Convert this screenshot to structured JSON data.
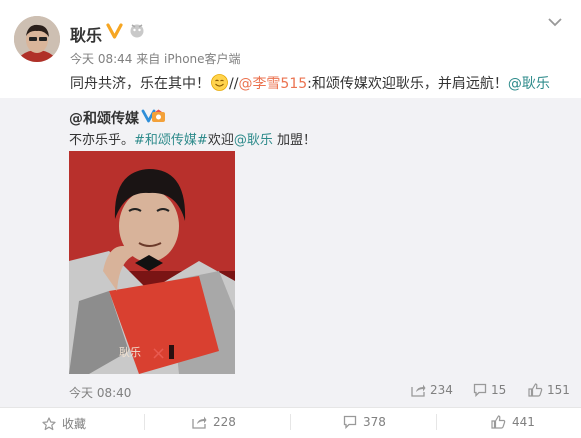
{
  "post": {
    "author": "耿乐",
    "meta": "今天 08:44 来自 iPhone客户端",
    "content_prefix": "同舟共济，乐在其中！",
    "content_sep": "//",
    "mention1": "@李雪515",
    "content_mid": ":和颂传媒欢迎耿乐，并肩远航！",
    "mention2": "@耿乐"
  },
  "repost": {
    "author": "@和颂传媒",
    "text_prefix": "不亦乐乎。",
    "hashtag": "#和颂传媒#",
    "text_mid": "欢迎",
    "mention": "@耿乐",
    "text_suffix": " 加盟！",
    "photo_caption": "耿乐",
    "time": "今天 08:40",
    "stats": {
      "forward": "234",
      "comment": "15",
      "like": "151"
    }
  },
  "actions": {
    "favorite": "收藏",
    "forward": "228",
    "comment": "378",
    "like": "441"
  },
  "colors": {
    "accent_link": "#eb7350",
    "topic_link": "#2e8b8b",
    "verified": "#f6a623",
    "repost_bg": "#f2f2f5"
  }
}
